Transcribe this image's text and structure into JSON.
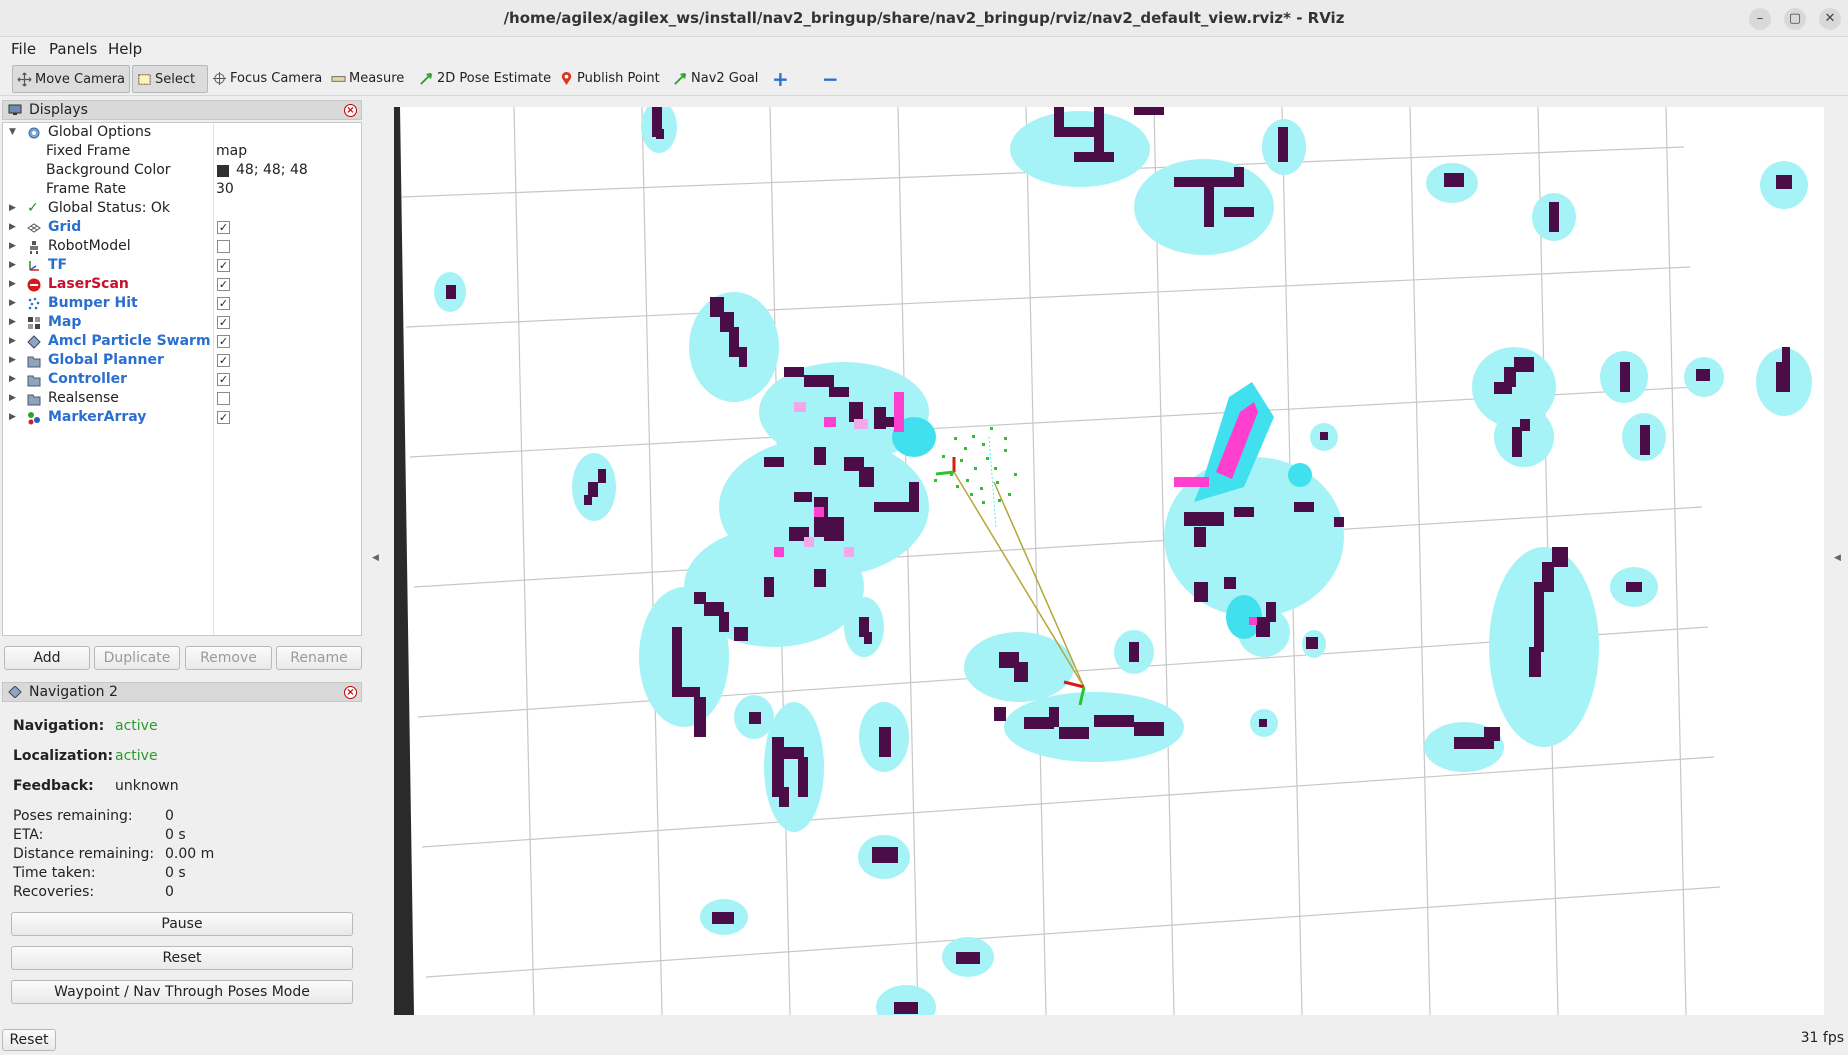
{
  "window": {
    "title": "/home/agilex/agilex_ws/install/nav2_bringup/share/nav2_bringup/rviz/nav2_default_view.rviz* - RViz",
    "controls": [
      "–",
      "▢",
      "✕"
    ]
  },
  "menu": {
    "file": "File",
    "panels": "Panels",
    "help": "Help"
  },
  "toolbar": {
    "move_camera": "Move Camera",
    "select": "Select",
    "focus_camera": "Focus Camera",
    "measure": "Measure",
    "pose_estimate": "2D Pose Estimate",
    "publish_point": "Publish Point",
    "nav2_goal": "Nav2 Goal",
    "add_tool": "+",
    "remove_tool": "−"
  },
  "displays": {
    "title": "Displays",
    "rows": [
      {
        "label": "Global Options",
        "value": ""
      },
      {
        "label": "Fixed Frame",
        "value": "map"
      },
      {
        "label": "Background Color",
        "value": "48; 48; 48"
      },
      {
        "label": "Frame Rate",
        "value": "30"
      },
      {
        "label": "Global Status: Ok",
        "value": ""
      },
      {
        "label": "Grid",
        "checked": "✓"
      },
      {
        "label": "RobotModel",
        "checked": ""
      },
      {
        "label": "TF",
        "checked": "✓"
      },
      {
        "label": "LaserScan",
        "checked": "✓"
      },
      {
        "label": "Bumper Hit",
        "checked": "✓"
      },
      {
        "label": "Map",
        "checked": "✓"
      },
      {
        "label": "Amcl Particle Swarm",
        "checked": "✓"
      },
      {
        "label": "Global Planner",
        "checked": "✓"
      },
      {
        "label": "Controller",
        "checked": "✓"
      },
      {
        "label": "Realsense",
        "checked": ""
      },
      {
        "label": "MarkerArray",
        "checked": "✓"
      }
    ],
    "buttons": {
      "add": "Add",
      "duplicate": "Duplicate",
      "remove": "Remove",
      "rename": "Rename"
    }
  },
  "navigation": {
    "title": "Navigation 2",
    "navigation_label": "Navigation:",
    "navigation_value": "active",
    "localization_label": "Localization:",
    "localization_value": "active",
    "feedback_label": "Feedback:",
    "feedback_value": "unknown",
    "poses_label": "Poses remaining:",
    "poses_value": "0",
    "eta_label": "ETA:",
    "eta_value": "0 s",
    "distance_label": "Distance remaining:",
    "distance_value": "0.00 m",
    "time_label": "Time taken:",
    "time_value": "0 s",
    "recoveries_label": "Recoveries:",
    "recoveries_value": "0",
    "pause_button": "Pause",
    "reset_button": "Reset",
    "waypoint_button": "Waypoint / Nav Through Poses Mode"
  },
  "status": {
    "reset": "Reset",
    "fps": "31 fps"
  },
  "colors": {
    "obstacle": "#4a0d48",
    "inflation": "#a6f3f7",
    "inflation_inner": "#41e0ef",
    "laser": "#ff3fd0",
    "particles": "#2bc42b",
    "path": "#b5a53a"
  }
}
